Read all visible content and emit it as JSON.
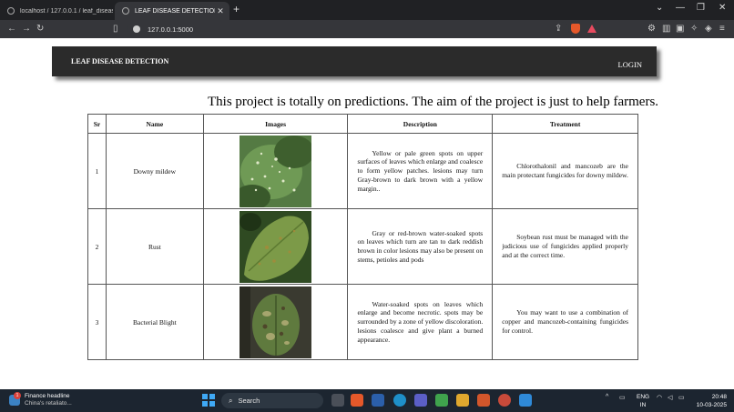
{
  "browser": {
    "tabs": [
      {
        "title": "localhost / 127.0.0.1 / leaf_disease |",
        "active": false
      },
      {
        "title": "LEAF DISEASE DETECTION",
        "active": true
      }
    ],
    "new_tab": "+",
    "url": "127.0.0.1:5000"
  },
  "site": {
    "brand": "LEAF DISEASE DETECTION",
    "login": "LOGIN",
    "tagline": "This project is totally on predictions. The aim of the project is just to help farmers."
  },
  "table": {
    "headers": [
      "Sr",
      "Name",
      "Images",
      "Description",
      "Treatment"
    ],
    "rows": [
      {
        "sr": "1",
        "name": "Downy mildew",
        "description": "Yellow or pale green spots on upper surfaces of leaves which enlarge and coalesce to form yellow patches. lesions may turn Gray-brown to dark brown with a yellow margin..",
        "treatment": "Chlorothalonil and mancozeb are the main protectant fungicides for downy mildew."
      },
      {
        "sr": "2",
        "name": "Rust",
        "description": "Gray or red-brown water-soaked spots on leaves which turn are tan to dark reddish brown in color lesions may also be present on stems, petioles and pods",
        "treatment": "Soybean rust must be managed with the judicious use of fungicides applied properly and at the correct time."
      },
      {
        "sr": "3",
        "name": "Bacterial Blight",
        "description": "Water-soaked spots on leaves which enlarge and become necrotic. spots may be surrounded by a zone of yellow discoloration. lesions coalesce and give plant a burned appearance.",
        "treatment": "You may want to use a combination of copper and mancozeb-containing fungicides for control."
      }
    ]
  },
  "taskbar": {
    "news_title": "Finance headline",
    "news_sub": "China's retaliato...",
    "news_badge": "1",
    "search_label": "Search",
    "lang_line1": "ENG",
    "lang_line2": "IN",
    "time": "20:48",
    "date": "10-03-2025"
  },
  "colors": {
    "navbar": "#2b2b2b",
    "taskbar": "#1c2530",
    "browser_frame": "#202124"
  }
}
